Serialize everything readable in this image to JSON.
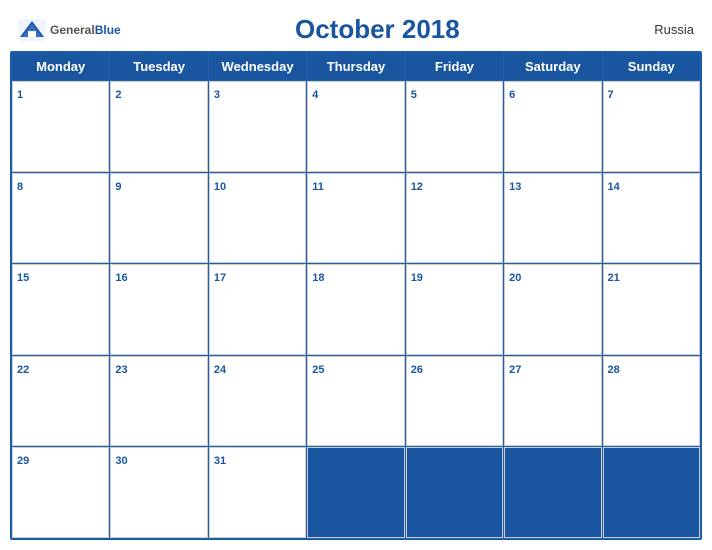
{
  "header": {
    "logo_general": "General",
    "logo_blue": "Blue",
    "title": "October 2018",
    "country": "Russia"
  },
  "weekdays": [
    "Monday",
    "Tuesday",
    "Wednesday",
    "Thursday",
    "Friday",
    "Saturday",
    "Sunday"
  ],
  "weeks": [
    [
      1,
      2,
      3,
      4,
      5,
      6,
      7
    ],
    [
      8,
      9,
      10,
      11,
      12,
      13,
      14
    ],
    [
      15,
      16,
      17,
      18,
      19,
      20,
      21
    ],
    [
      22,
      23,
      24,
      25,
      26,
      27,
      28
    ],
    [
      29,
      30,
      31,
      null,
      null,
      null,
      null
    ]
  ]
}
